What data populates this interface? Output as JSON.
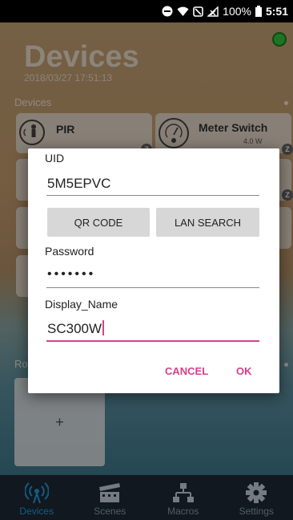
{
  "status_bar": {
    "battery": "100%",
    "time": "5:51"
  },
  "header": {
    "title": "Devices",
    "datetime": "2018/03/27 17:51:13"
  },
  "devices_section": {
    "label": "Devices",
    "cards": [
      {
        "name": "PIR",
        "sub": ""
      },
      {
        "name": "Meter Switch",
        "sub": "4.0 W"
      }
    ]
  },
  "rooms_section": {
    "label": "Ro",
    "add_label": "+"
  },
  "dialog": {
    "uid_label": "UID",
    "uid_value": "5M5EPVC",
    "qr_button": "QR CODE",
    "lan_button": "LAN SEARCH",
    "password_label": "Password",
    "password_value": "•••••••",
    "display_name_label": "Display_Name",
    "display_name_value": "SC300W",
    "cancel_label": "CANCEL",
    "ok_label": "OK"
  },
  "bottom_nav": [
    {
      "label": "Devices",
      "icon": "wireless-icon",
      "active": true
    },
    {
      "label": "Scenes",
      "icon": "clapperboard-icon",
      "active": false
    },
    {
      "label": "Macros",
      "icon": "flow-icon",
      "active": false
    },
    {
      "label": "Settings",
      "icon": "gear-icon",
      "active": false
    }
  ],
  "colors": {
    "accent": "#d6408a",
    "nav_active": "#1ea1e5",
    "online": "#35c83a"
  }
}
